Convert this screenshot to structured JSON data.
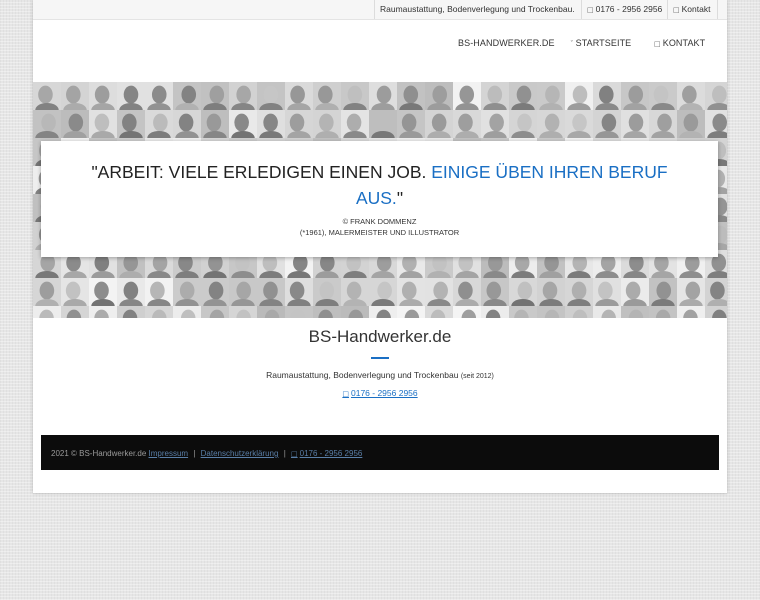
{
  "topbar": {
    "slogan": "Raumaustattung, Bodenverlegung und Trockenbau.",
    "phone": "0176 - 2956 2956",
    "contact": "Kontakt"
  },
  "nav": {
    "brand": "BS-HANDWERKER.DE",
    "start": "STARTSEITE",
    "kontakt": "KONTAKT"
  },
  "quote": {
    "text_black": "\"ARBEIT: VIELE ERLEDIGEN EINEN JOB.",
    "text_blue": "EINIGE ÜBEN IHREN BERUF AUS.",
    "text_end": "\"",
    "author_line1": "© FRANK DOMMENZ",
    "author_line2": "(*1961), MALERMEISTER UND ILLUSTRATOR"
  },
  "brand": {
    "title": "BS-Handwerker.de",
    "subtitle": "Raumaustattung, Bodenverlegung und Trockenbau",
    "since": "(seit 2012)",
    "phone": "0176 - 2956 2956"
  },
  "footer": {
    "copyright": "2021 © BS-Handwerker.de",
    "impressum": "Impressum",
    "datenschutz": "Datenschutzerklärung",
    "phone": "0176 - 2956 2956",
    "separator": "|"
  },
  "colors": {
    "accent": "#1a6fc4",
    "footer_bg": "#0c0c0c",
    "page_bg": "#e6e6e6"
  },
  "icons": {
    "phone": "phone-icon",
    "contact": "envelope-icon",
    "start": "home-icon"
  }
}
